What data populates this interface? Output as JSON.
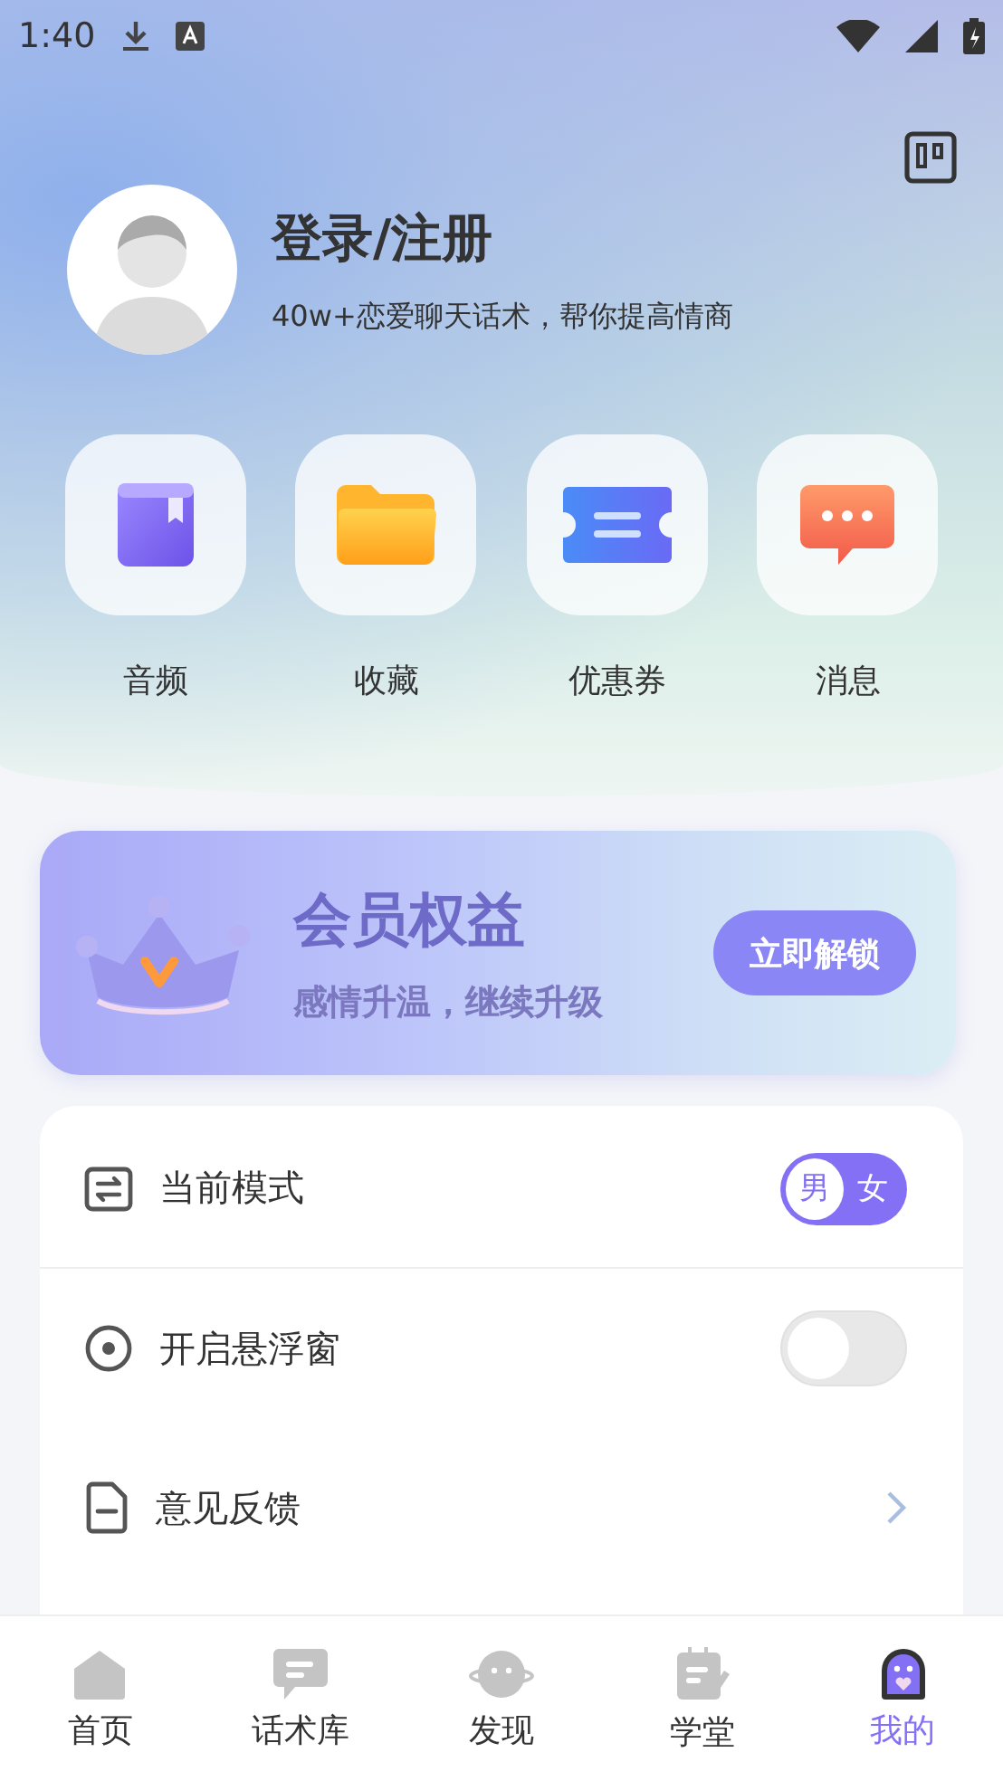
{
  "status_bar": {
    "time": "1:40"
  },
  "profile": {
    "title": "登录/注册",
    "subtitle": "40w+恋爱聊天话术，帮你提高情商"
  },
  "shortcuts": [
    {
      "kind": "audio",
      "label": "音频"
    },
    {
      "kind": "favorites",
      "label": "收藏"
    },
    {
      "kind": "coupon",
      "label": "优惠券"
    },
    {
      "kind": "messages",
      "label": "消息"
    }
  ],
  "vip_banner": {
    "title": "会员权益",
    "subtitle": "感情升温，继续升级",
    "button": "立即解锁"
  },
  "settings": [
    {
      "kind": "mode",
      "label": "当前模式",
      "options": [
        {
          "label": "男",
          "selected": true
        },
        {
          "label": "女",
          "selected": false
        }
      ]
    },
    {
      "kind": "switch",
      "label": "开启悬浮窗",
      "on": false
    },
    {
      "kind": "link",
      "label": "意见反馈"
    }
  ],
  "tab_bar": [
    {
      "kind": "home",
      "label": "首页",
      "selected": false
    },
    {
      "kind": "library",
      "label": "话术库",
      "selected": false
    },
    {
      "kind": "discover",
      "label": "发现",
      "selected": false
    },
    {
      "kind": "school",
      "label": "学堂",
      "selected": false
    },
    {
      "kind": "mine",
      "label": "我的",
      "selected": true
    }
  ]
}
